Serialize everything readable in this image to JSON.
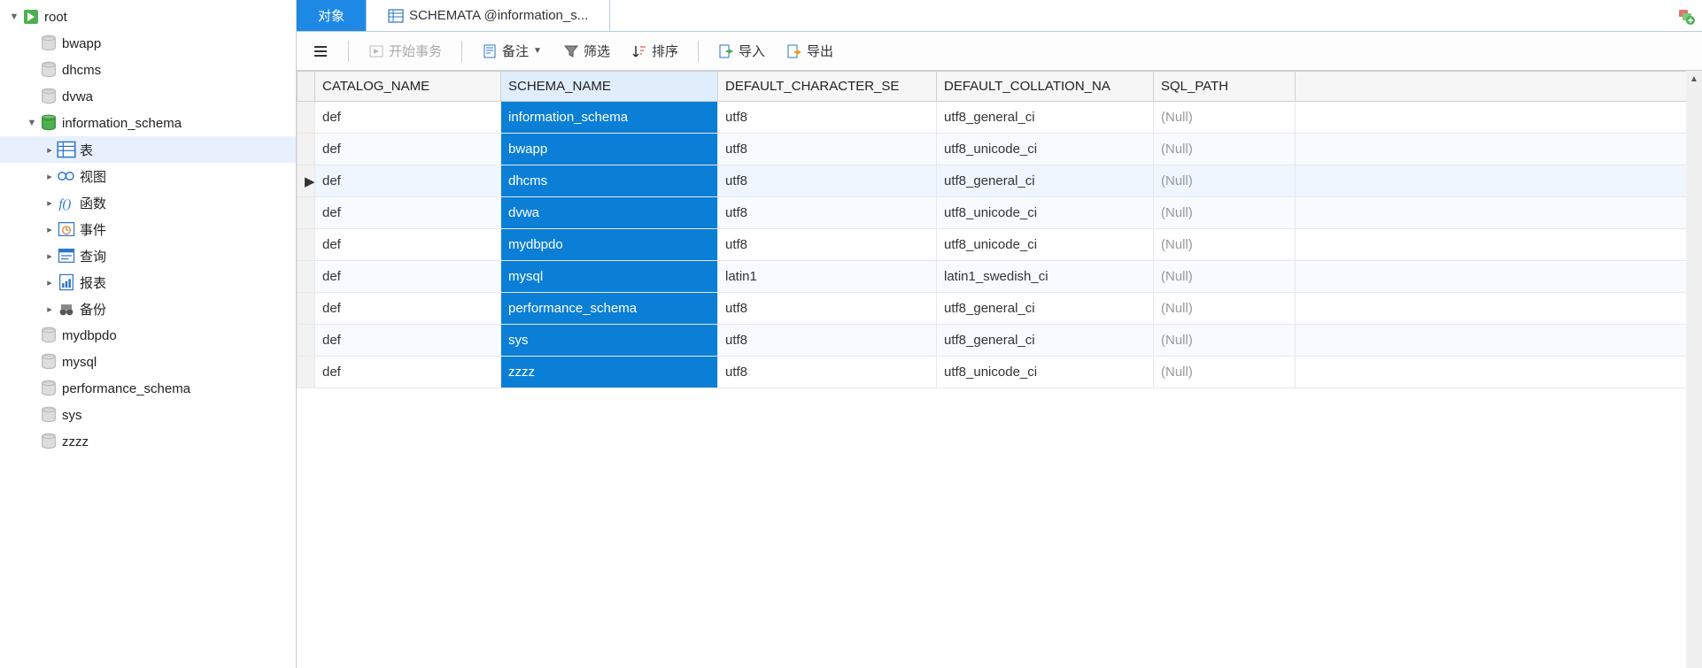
{
  "sidebar": {
    "root": "root",
    "databases": [
      "bwapp",
      "dhcms",
      "dvwa",
      "information_schema",
      "mydbpdo",
      "mysql",
      "performance_schema",
      "sys",
      "zzzz"
    ],
    "active_db_index": 3,
    "schema_children": [
      {
        "label": "表",
        "icon": "table"
      },
      {
        "label": "视图",
        "icon": "view"
      },
      {
        "label": "函数",
        "icon": "func"
      },
      {
        "label": "事件",
        "icon": "event"
      },
      {
        "label": "查询",
        "icon": "query"
      },
      {
        "label": "报表",
        "icon": "report"
      },
      {
        "label": "备份",
        "icon": "backup"
      }
    ]
  },
  "tabs": {
    "object": "对象",
    "data_tab": "SCHEMATA @information_s..."
  },
  "toolbar": {
    "begin_tx": "开始事务",
    "memo": "备注",
    "filter": "筛选",
    "sort": "排序",
    "import": "导入",
    "export": "导出"
  },
  "table": {
    "columns": [
      "CATALOG_NAME",
      "SCHEMA_NAME",
      "DEFAULT_CHARACTER_SE",
      "DEFAULT_COLLATION_NA",
      "SQL_PATH"
    ],
    "sorted_col_index": 1,
    "current_row_index": 2,
    "rows": [
      {
        "catalog": "def",
        "schema": "information_schema",
        "charset": "utf8",
        "collation": "utf8_general_ci",
        "sql_path": null
      },
      {
        "catalog": "def",
        "schema": "bwapp",
        "charset": "utf8",
        "collation": "utf8_unicode_ci",
        "sql_path": null
      },
      {
        "catalog": "def",
        "schema": "dhcms",
        "charset": "utf8",
        "collation": "utf8_general_ci",
        "sql_path": null
      },
      {
        "catalog": "def",
        "schema": "dvwa",
        "charset": "utf8",
        "collation": "utf8_unicode_ci",
        "sql_path": null
      },
      {
        "catalog": "def",
        "schema": "mydbpdo",
        "charset": "utf8",
        "collation": "utf8_unicode_ci",
        "sql_path": null
      },
      {
        "catalog": "def",
        "schema": "mysql",
        "charset": "latin1",
        "collation": "latin1_swedish_ci",
        "sql_path": null
      },
      {
        "catalog": "def",
        "schema": "performance_schema",
        "charset": "utf8",
        "collation": "utf8_general_ci",
        "sql_path": null
      },
      {
        "catalog": "def",
        "schema": "sys",
        "charset": "utf8",
        "collation": "utf8_general_ci",
        "sql_path": null
      },
      {
        "catalog": "def",
        "schema": "zzzz",
        "charset": "utf8",
        "collation": "utf8_unicode_ci",
        "sql_path": null
      }
    ],
    "null_text": "(Null)"
  }
}
